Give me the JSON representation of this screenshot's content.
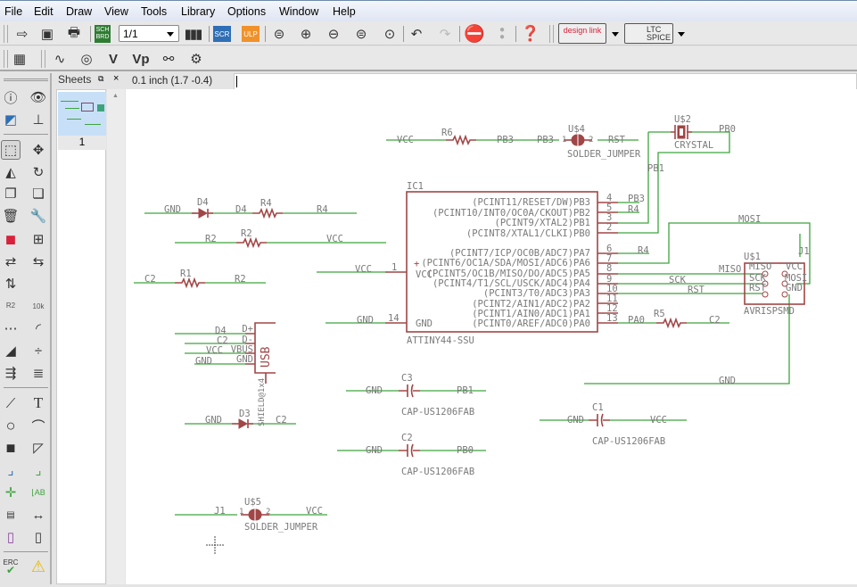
{
  "menu": [
    "File",
    "Edit",
    "Draw",
    "View",
    "Tools",
    "Library",
    "Options",
    "Window",
    "Help"
  ],
  "toolbar": {
    "sheet_select": "1/1",
    "icons": [
      "open-icon",
      "save-icon",
      "print-icon",
      "sch-brd-switch-icon",
      "sheets-icon",
      "script-icon",
      "ulp-icon",
      "zoom-fit-icon",
      "zoom-in-icon",
      "zoom-out-icon",
      "zoom-select-icon",
      "zoom-last-icon",
      "undo-icon",
      "redo-icon",
      "stop-icon",
      "go-icon",
      "help-icon"
    ],
    "sch_brd": "SCH BRD",
    "scr": "SCR",
    "ulp": "ULP",
    "designlink": "design link",
    "ltspice": "LTC SPICE",
    "colors": {
      "scr": "#2f6fb6",
      "ulp": "#f0922b",
      "stop": "#d8213a"
    }
  },
  "toolbar2": {
    "icons": [
      "grid-icon",
      "net-icon",
      "show-icon",
      "value-icon",
      "value-p-icon",
      "attribute-icon",
      "settings-icon"
    ],
    "v": "V",
    "vp": "Vp"
  },
  "sheets_panel": {
    "title": "Sheets",
    "sheet_number": "1"
  },
  "status": {
    "coordinates": "0.1 inch (1.7 -0.4)",
    "command": ""
  },
  "left_tools": {
    "r2": "R2",
    "r2_value": "10k",
    "text_tool": "T",
    "erc": "ERC"
  },
  "schematic": {
    "colors": {
      "wire": "#3fa33f",
      "part": "#a04646",
      "text": "#7a7a7a"
    },
    "ic1": {
      "name": "IC1",
      "value": "ATTINY44-SSU",
      "plus": "+",
      "left_pins": [
        {
          "num": "1",
          "name": "VCC"
        },
        {
          "num": "14",
          "name": "GND"
        }
      ],
      "right_pins": [
        {
          "num": "4",
          "name": "(PCINT11/RESET/DW)PB3"
        },
        {
          "num": "5",
          "name": "(PCINT10/INT0/OC0A/CKOUT)PB2"
        },
        {
          "num": "3",
          "name": "(PCINT9/XTAL2)PB1"
        },
        {
          "num": "2",
          "name": "(PCINT8/XTAL1/CLKI)PB0"
        },
        {
          "num": "6",
          "name": "(PCINT7/ICP/OC0B/ADC7)PA7"
        },
        {
          "num": "7",
          "name": "(PCINT6/OC1A/SDA/MOSI/ADC6)PA6"
        },
        {
          "num": "8",
          "name": "(PCINT5/OC1B/MISO/DO/ADC5)PA5"
        },
        {
          "num": "9",
          "name": "(PCINT4/T1/SCL/USCK/ADC4)PA4"
        },
        {
          "num": "10",
          "name": "(PCINT3/T0/ADC3)PA3"
        },
        {
          "num": "11",
          "name": "(PCINT2/AIN1/ADC2)PA2"
        },
        {
          "num": "12",
          "name": "(PCINT1/AIN0/ADC1)PA1"
        },
        {
          "num": "13",
          "name": "(PCINT0/AREF/ADC0)PA0"
        }
      ]
    },
    "parts": {
      "r6": "R6",
      "r4": "R4",
      "r2": "R2",
      "r1": "R1",
      "r5": "R5",
      "d4": "D4",
      "d3": "D3",
      "us4": {
        "name": "U$4",
        "value": "SOLDER_JUMPER",
        "pin1": "1",
        "pin2": "2"
      },
      "us5": {
        "name": "U$5",
        "value": "SOLDER_JUMPER",
        "pin1": "1",
        "pin2": "2"
      },
      "us2": {
        "name": "U$2",
        "value": "CRYSTAL"
      },
      "c3": {
        "name": "C3",
        "value": "CAP-US1206FAB"
      },
      "c2": {
        "name": "C2",
        "value": "CAP-US1206FAB"
      },
      "c1": {
        "name": "C1",
        "value": "CAP-US1206FAB"
      },
      "usb": {
        "label": "USB",
        "pins": [
          "D+",
          "D-",
          "VBUS",
          "GND"
        ],
        "shield": "SHIELD@1x4"
      },
      "us1": {
        "name": "U$1",
        "value": "AVRISPSMD",
        "pins": [
          "MISO",
          "SCK",
          "RST",
          "VCC",
          "MOSI",
          "GND"
        ]
      }
    },
    "net_labels": [
      "VCC",
      "PB3",
      "PB3",
      "RST",
      "PB0",
      "PB1",
      "PB3",
      "R4",
      "R4",
      "MOSI",
      "MISO",
      "SCK",
      "RST",
      "PA0",
      "C2",
      "J1",
      "GND",
      "VCC",
      "GND",
      "GND",
      "D4",
      "R4",
      "R2",
      "VCC",
      "C2",
      "R2",
      "D4",
      "C2",
      "VCC",
      "GND",
      "GND",
      "C2",
      "GND",
      "PB1",
      "GND",
      "PB0",
      "GND",
      "VCC",
      "J1",
      "VCC"
    ]
  }
}
